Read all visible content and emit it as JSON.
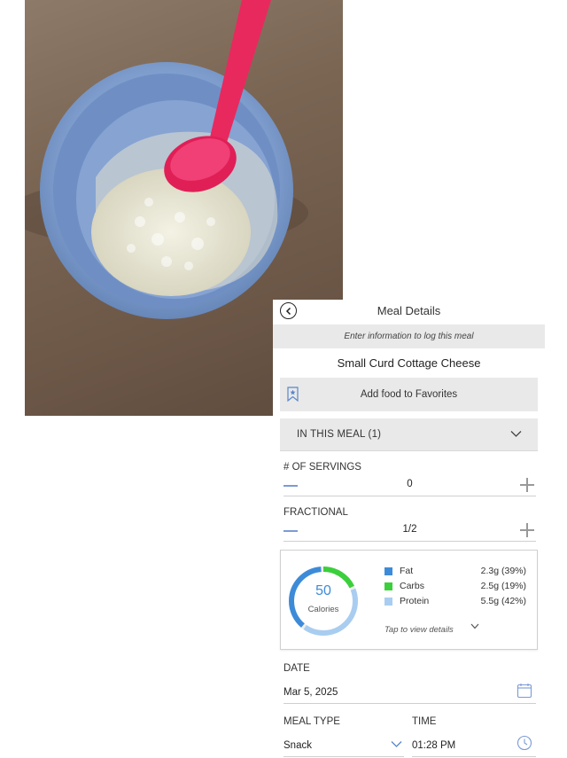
{
  "header": {
    "title": "Meal Details",
    "subtitle": "Enter information to log this meal"
  },
  "food": {
    "name": "Small Curd Cottage Cheese"
  },
  "favorites": {
    "label": "Add food to Favorites",
    "icon": "bookmark-star-icon"
  },
  "meal": {
    "label": "IN THIS MEAL (1)"
  },
  "servings": {
    "label": "# OF SERVINGS",
    "value": "0"
  },
  "fractional": {
    "label": "FRACTIONAL",
    "value": "1/2"
  },
  "nutrition": {
    "calories_value": "50",
    "calories_label": "Calories",
    "macros": [
      {
        "name": "Fat",
        "value": "2.3g (39%)",
        "color": "#3d8bd8",
        "percent": 39
      },
      {
        "name": "Carbs",
        "value": "2.5g (19%)",
        "color": "#3ccf3c",
        "percent": 19
      },
      {
        "name": "Protein",
        "value": "5.5g (42%)",
        "color": "#a8cdf0",
        "percent": 42
      }
    ],
    "details_link": "Tap to view details"
  },
  "date": {
    "label": "DATE",
    "value": "Mar 5, 2025"
  },
  "meal_type": {
    "label": "MEAL TYPE",
    "value": "Snack"
  },
  "time": {
    "label": "TIME",
    "value": "01:28 PM"
  }
}
